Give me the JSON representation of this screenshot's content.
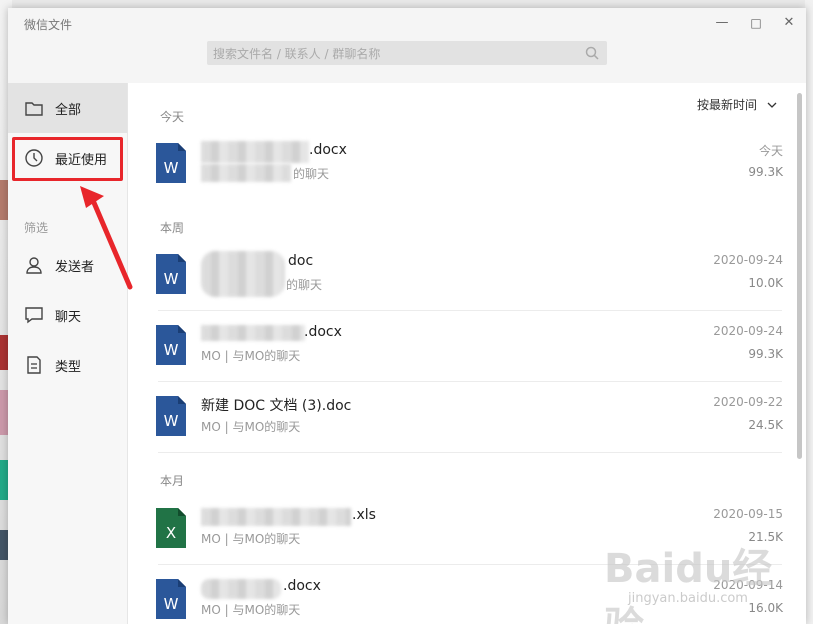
{
  "app": {
    "title": "微信文件"
  },
  "search": {
    "placeholder": "搜索文件名 / 联系人 / 群聊名称"
  },
  "window_controls": {
    "minimize": "—",
    "maximize": "□",
    "close": "✕"
  },
  "sidebar": {
    "items": [
      {
        "label": "全部",
        "icon": "folder-icon"
      },
      {
        "label": "最近使用",
        "icon": "clock-icon"
      }
    ],
    "filter_label": "筛选",
    "filters": [
      {
        "label": "发送者",
        "icon": "person-icon"
      },
      {
        "label": "聊天",
        "icon": "chat-bubble-icon"
      },
      {
        "label": "类型",
        "icon": "document-icon"
      }
    ]
  },
  "sort": {
    "label": "按最新时间"
  },
  "sections": {
    "today": "今天",
    "this_week": "本周",
    "this_month": "本月"
  },
  "files": [
    {
      "name": ".docx",
      "subtitle": "的聊天",
      "date": "今天",
      "size": "99.3K",
      "type": "word"
    },
    {
      "name": "doc",
      "subtitle": "的聊天",
      "date": "2020-09-24",
      "size": "10.0K",
      "type": "word"
    },
    {
      "name": ".docx",
      "subtitle": "MO | 与MO的聊天",
      "date": "2020-09-24",
      "size": "99.3K",
      "type": "word"
    },
    {
      "name": "新建 DOC 文档 (3).doc",
      "subtitle": "MO | 与MO的聊天",
      "date": "2020-09-22",
      "size": "24.5K",
      "type": "word"
    },
    {
      "name": ".xls",
      "subtitle": "MO | 与MO的聊天",
      "date": "2020-09-15",
      "size": "21.5K",
      "type": "excel"
    },
    {
      "name": ".docx",
      "subtitle": "MO | 与MO的聊天",
      "date": "2020-09-14",
      "size": "16.0K",
      "type": "word"
    }
  ],
  "file_icon_letters": {
    "word": "W",
    "excel": "X"
  },
  "colors": {
    "word": "#2b579a",
    "excel": "#217346",
    "highlight": "#e8262b"
  },
  "watermark": {
    "brand": "Baidu经验",
    "url": "jingyan.baidu.com"
  }
}
